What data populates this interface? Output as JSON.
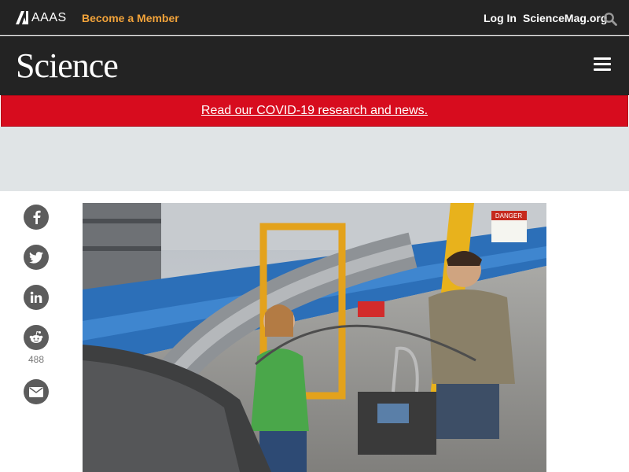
{
  "topbar": {
    "logo_text": "AAAS",
    "member_label": "Become a Member",
    "login_label": "Log In",
    "site_label": "ScienceMag.org"
  },
  "masthead": {
    "logo_text": "Science"
  },
  "banner": {
    "text": "Read our COVID-19 research and news."
  },
  "share": {
    "reddit_count": "488",
    "icons": [
      "facebook-icon",
      "twitter-icon",
      "linkedin-icon",
      "reddit-icon",
      "email-icon"
    ]
  },
  "hero_image": {
    "sign_text": "DANGER"
  },
  "colors": {
    "header_bg": "#232323",
    "accent_orange": "#f2a33a",
    "banner_red": "#d70c1e",
    "ad_bg": "#e0e4e6",
    "share_icon_bg": "#5c5c5c"
  }
}
